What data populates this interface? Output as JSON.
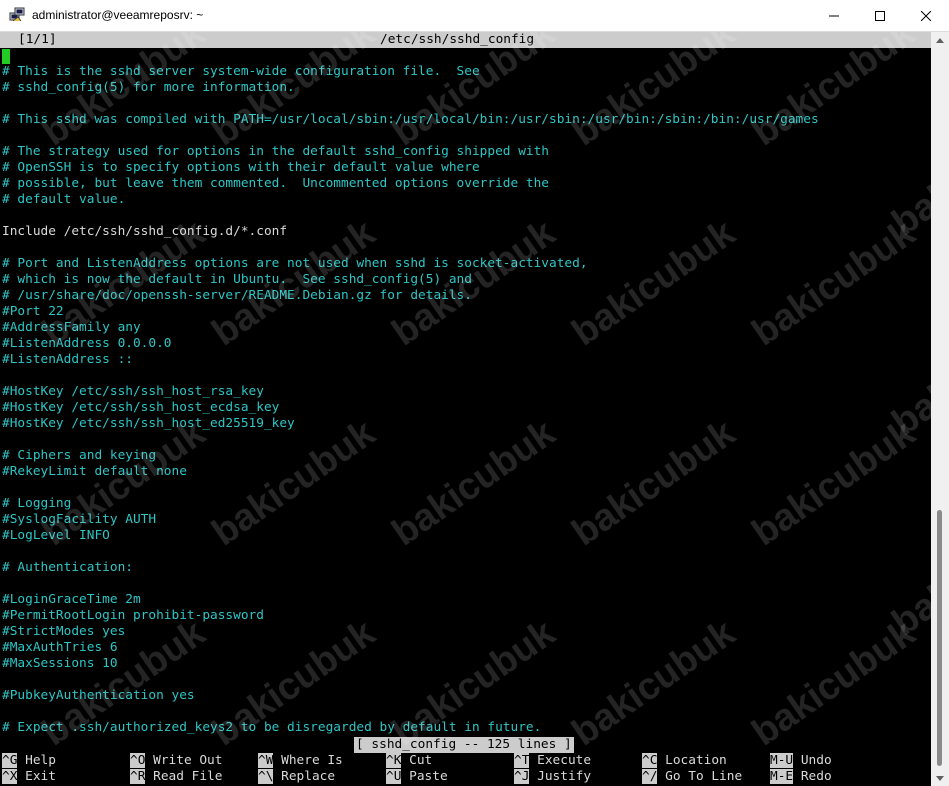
{
  "window": {
    "title": "administrator@veeamreposrv: ~",
    "icon": "putty-icon"
  },
  "editor": {
    "version": "[1/1]",
    "filename": "/etc/ssh/sshd_config",
    "status_message": "[ sshd_config -- 125 lines ]",
    "lines": [
      "",
      "# This is the sshd server system-wide configuration file.  See",
      "# sshd_config(5) for more information.",
      "",
      "# This sshd was compiled with PATH=/usr/local/sbin:/usr/local/bin:/usr/sbin:/usr/bin:/sbin:/bin:/usr/games",
      "",
      "# The strategy used for options in the default sshd_config shipped with",
      "# OpenSSH is to specify options with their default value where",
      "# possible, but leave them commented.  Uncommented options override the",
      "# default value.",
      "",
      "Include /etc/ssh/sshd_config.d/*.conf",
      "",
      "# Port and ListenAddress options are not used when sshd is socket-activated,",
      "# which is now the default in Ubuntu.  See sshd_config(5) and",
      "# /usr/share/doc/openssh-server/README.Debian.gz for details.",
      "#Port 22",
      "#AddressFamily any",
      "#ListenAddress 0.0.0.0",
      "#ListenAddress ::",
      "",
      "#HostKey /etc/ssh/ssh_host_rsa_key",
      "#HostKey /etc/ssh/ssh_host_ecdsa_key",
      "#HostKey /etc/ssh/ssh_host_ed25519_key",
      "",
      "# Ciphers and keying",
      "#RekeyLimit default none",
      "",
      "# Logging",
      "#SyslogFacility AUTH",
      "#LogLevel INFO",
      "",
      "# Authentication:",
      "",
      "#LoginGraceTime 2m",
      "#PermitRootLogin prohibit-password",
      "#StrictModes yes",
      "#MaxAuthTries 6",
      "#MaxSessions 10",
      "",
      "#PubkeyAuthentication yes",
      "",
      "# Expect .ssh/authorized_keys2 to be disregarded by default in future."
    ],
    "shortcuts": [
      [
        {
          "key": "^G",
          "label": "Help"
        },
        {
          "key": "^O",
          "label": "Write Out"
        },
        {
          "key": "^W",
          "label": "Where Is"
        },
        {
          "key": "^K",
          "label": "Cut"
        },
        {
          "key": "^T",
          "label": "Execute"
        },
        {
          "key": "^C",
          "label": "Location"
        },
        {
          "key": "M-U",
          "label": "Undo"
        }
      ],
      [
        {
          "key": "^X",
          "label": "Exit"
        },
        {
          "key": "^R",
          "label": "Read File"
        },
        {
          "key": "^\\",
          "label": "Replace"
        },
        {
          "key": "^U",
          "label": "Paste"
        },
        {
          "key": "^J",
          "label": "Justify"
        },
        {
          "key": "^/",
          "label": "Go To Line"
        },
        {
          "key": "M-E",
          "label": "Redo"
        }
      ]
    ]
  },
  "watermark": "bakicubuk",
  "colors": {
    "comment": "#2ec5c5",
    "text": "#d9d9d9",
    "cursor": "#22cc22",
    "bar": "#cccccc"
  }
}
